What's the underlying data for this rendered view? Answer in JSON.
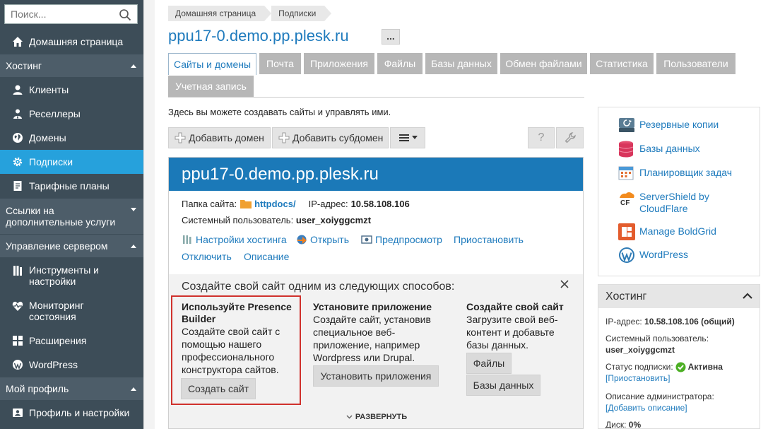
{
  "sidebar": {
    "search_placeholder": "Поиск...",
    "items": {
      "home": "Домашняя страница",
      "hosting": "Хостинг",
      "clients": "Клиенты",
      "resellers": "Реселлеры",
      "domains": "Домены",
      "subscriptions": "Подписки",
      "plans": "Тарифные планы",
      "links_line1": "Ссылки на",
      "links_line2": "дополнительные услуги",
      "server_mgmt": "Управление сервером",
      "tools_line1": "Инструменты и",
      "tools_line2": "настройки",
      "monitoring_line1": "Мониторинг",
      "monitoring_line2": "состояния",
      "extensions": "Расширения",
      "wordpress": "WordPress",
      "my_profile": "Мой профиль",
      "profile_settings": "Профиль и настройки"
    },
    "active": "subscriptions",
    "active_color": "#26a1dc"
  },
  "breadcrumb": [
    "Домашняя страница",
    "Подписки"
  ],
  "page_title": "ppu17-0.demo.pp.plesk.ru",
  "title_more": "...",
  "tabs": [
    "Сайты и домены",
    "Почта",
    "Приложения",
    "Файлы",
    "Базы данных",
    "Обмен файлами",
    "Статистика",
    "Пользователи",
    "Учетная запись"
  ],
  "intro": "Здесь вы можете создавать сайты и управлять ими.",
  "toolbar": {
    "add_domain": "Добавить домен",
    "add_subdomain": "Добавить субдомен",
    "help": "?"
  },
  "domain": {
    "name": "ppu17-0.demo.pp.plesk.ru",
    "folder_label": "Папка сайта:",
    "folder_value": "httpdocs/",
    "ip_label": "IP-адрес:",
    "ip_value": "10.58.108.106",
    "sysuser_label": "Системный пользователь:",
    "sysuser_value": "user_xoiyggcmzt",
    "actions": {
      "hosting_settings": "Настройки хостинга",
      "open": "Открыть",
      "preview": "Предпросмотр",
      "suspend": "Приостановить",
      "disable": "Отключить",
      "description": "Описание"
    },
    "create": {
      "title": "Создайте свой сайт одним из следующих способов:",
      "presence": {
        "title_line1": "Используйте Presence",
        "title_line2": "Builder",
        "desc": [
          "Создайте свой сайт с",
          "помощью нашего",
          "профессионального",
          "конструктора сайтов."
        ],
        "button": "Создать сайт"
      },
      "app": {
        "title": "Установите приложение",
        "desc": [
          "Создайте сайт, установив",
          "специальное веб-",
          "приложение, например",
          "Wordpress или Drupal."
        ],
        "button": "Установить приложения"
      },
      "own": {
        "title": "Создайте свой сайт",
        "desc": [
          "Загрузите свой веб-",
          "контент и добавьте",
          "базы данных."
        ],
        "button_files": "Файлы",
        "button_db": "Базы данных"
      },
      "expand": "РАЗВЕРНУТЬ"
    }
  },
  "tools": {
    "backups": "Резервные копии",
    "databases": "Базы данных",
    "scheduler": "Планировщик задач",
    "servershield_line1": "ServerShield by",
    "servershield_line2": "CloudFlare",
    "boldgrid": "Manage BoldGrid",
    "wordpress": "WordPress"
  },
  "hosting": {
    "title": "Хостинг",
    "ip_label": "IP-адрес:",
    "ip_value": "10.58.108.106 (общий)",
    "sysuser_label": "Системный пользователь:",
    "sysuser_value": "user_xoiyggcmzt",
    "status_label": "Статус подписки:",
    "status_value": "Активна",
    "suspend_link": "[Приостановить]",
    "admin_desc_label": "Описание администратора:",
    "admin_desc_link": "[Добавить описание]",
    "disk_label": "Диск:",
    "disk_value": "0%"
  }
}
